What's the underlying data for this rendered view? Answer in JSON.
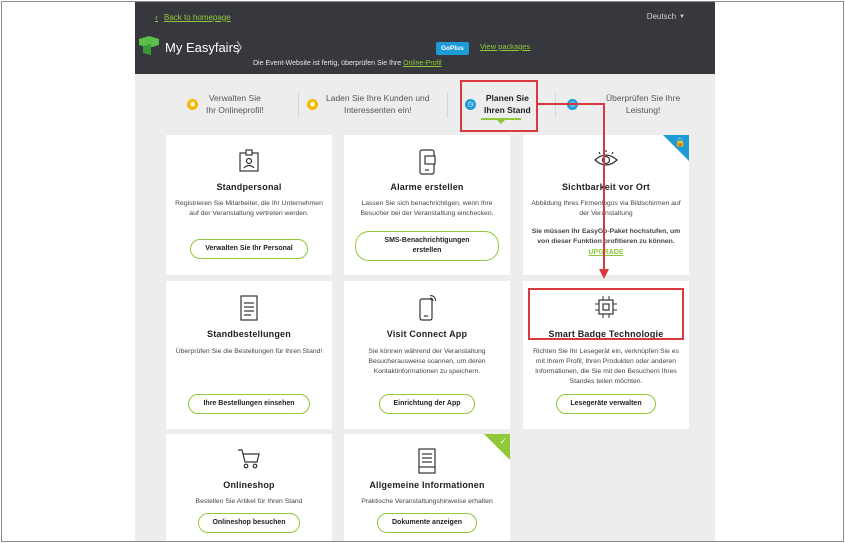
{
  "header": {
    "back_link": "Back to homepage",
    "language": "Deutsch",
    "app_title": "My Easyfairs",
    "goplus_badge": "GoPlus",
    "view_packages": "View packages",
    "notice_text": "Die Event-Website ist fertig, überprüfen Sie Ihre",
    "notice_link": "Online-Profil"
  },
  "steps": [
    {
      "line1": "Verwalten Sie",
      "line2": "Ihr Onlineprofil!"
    },
    {
      "line1": "Laden Sie Ihre Kunden und",
      "line2": "Interessenten ein!"
    },
    {
      "line1": "Planen Sie",
      "line2": "Ihren Stand"
    },
    {
      "line1": "Überprüfen Sie Ihre",
      "line2": "Leistung!"
    }
  ],
  "cards": [
    {
      "title": "Standpersonal",
      "text": "Registrieren Sie Mitarbeiter, die Ihr Unternehmen auf der Veranstaltung vertreten werden.",
      "button": "Verwalten Sie Ihr Personal"
    },
    {
      "title": "Alarme erstellen",
      "text": "Lassen Sie sich benachrichtigen, wenn Ihre Besucher bei der Veranstaltung einchecken.",
      "button_line1": "SMS-Benachrichtigungen",
      "button_line2": "erstellen"
    },
    {
      "title": "Sichtbarkeit vor Ort",
      "text": "Abbildung Ihres Firmenlogos via Bildschirmen auf der Veranstaltung",
      "note": "Sie müssen Ihr EasyGo-Paket hochstufen, um von dieser Funktion profitieren zu können.",
      "upgrade": "UPGRADE"
    },
    {
      "title": "Standbestellungen",
      "text": "Überprüfen Sie die Bestellungen für Ihren Stand!",
      "button": "Ihre Bestellungen einsehen"
    },
    {
      "title": "Visit Connect App",
      "text": "Sie können während der Veranstaltung Besucherausweise scannen, um deren Kontaktinformationen zu speichern.",
      "button": "Einrichtung der App"
    },
    {
      "title": "Smart Badge Technologie",
      "text": "Richten Sie Ihr Lesegerät ein, verknüpfen Sie es mit Ihrem Profil, Ihren Produkten oder anderen Informationen, die Sie mit den Besuchern Ihres Standes teilen möchten.",
      "button": "Lesegeräte verwalten"
    },
    {
      "title": "Onlineshop",
      "text": "Bestellen Sie Artikel für Ihren Stand",
      "button": "Onlineshop besuchen"
    },
    {
      "title": "Allgemeine Informationen",
      "text": "Praktische Veranstaltungshinweise erhalten",
      "button": "Dokumente anzeigen"
    }
  ],
  "colors": {
    "accent_green": "#8fc93a",
    "accent_blue": "#1e9ad6",
    "step_yellow": "#f5b800",
    "highlight_red": "#d9393d",
    "header_dark": "#37383d"
  }
}
